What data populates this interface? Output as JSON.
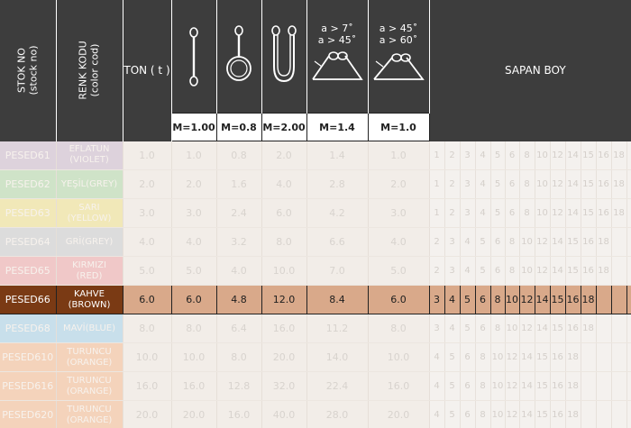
{
  "header": {
    "stok_label": "STOK NO",
    "stok_sub": "(stock no)",
    "renk_label": "RENK KODU",
    "renk_sub": "(color cod)",
    "ton_label": "TON ( t )",
    "sapan_label": "SAPAN BOY",
    "angle_a": [
      "a > 7˚",
      "a > 45˚"
    ],
    "angle_b": [
      "a > 45˚",
      "a > 60˚"
    ],
    "multipliers": [
      "M=1.00",
      "M=0.8",
      "M=2.00",
      "M=1.4",
      "M=1.0"
    ]
  },
  "rows": [
    {
      "stok": "PESED61",
      "renk": [
        "EFLATUN",
        "(VIOLET)"
      ],
      "color": "#ddd2dc",
      "ton": "1.0",
      "m": [
        "1.0",
        "0.8",
        "2.0",
        "1.4",
        "1.0"
      ],
      "sizes": [
        "1",
        "2",
        "3",
        "4",
        "5",
        "6",
        "8",
        "10",
        "12",
        "14",
        "15",
        "16",
        "18"
      ],
      "highlight": false
    },
    {
      "stok": "PESED62",
      "renk": [
        "YEŞİL(GREY)"
      ],
      "color": "#cfe3c8",
      "ton": "2.0",
      "m": [
        "2.0",
        "1.6",
        "4.0",
        "2.8",
        "2.0"
      ],
      "sizes": [
        "1",
        "2",
        "3",
        "4",
        "5",
        "6",
        "8",
        "10",
        "12",
        "14",
        "15",
        "16",
        "18"
      ],
      "highlight": false
    },
    {
      "stok": "PESED63",
      "renk": [
        "SARI",
        "(YELLOW)"
      ],
      "color": "#f1e8b8",
      "ton": "3.0",
      "m": [
        "3.0",
        "2.4",
        "6.0",
        "4.2",
        "3.0"
      ],
      "sizes": [
        "1",
        "2",
        "3",
        "4",
        "5",
        "6",
        "8",
        "10",
        "12",
        "14",
        "15",
        "16",
        "18"
      ],
      "highlight": false
    },
    {
      "stok": "PESED64",
      "renk": [
        "GRİ(GREY)"
      ],
      "color": "#dcdcdc",
      "ton": "4.0",
      "m": [
        "4.0",
        "3.2",
        "8.0",
        "6.6",
        "4.0"
      ],
      "sizes": [
        "2",
        "3",
        "4",
        "5",
        "6",
        "8",
        "10",
        "12",
        "14",
        "15",
        "16",
        "18"
      ],
      "highlight": false
    },
    {
      "stok": "PESED65",
      "renk": [
        "KIRMIZI",
        "(RED)"
      ],
      "color": "#f0c8c8",
      "ton": "5.0",
      "m": [
        "5.0",
        "4.0",
        "10.0",
        "7.0",
        "5.0"
      ],
      "sizes": [
        "2",
        "3",
        "4",
        "5",
        "6",
        "8",
        "10",
        "12",
        "14",
        "15",
        "16",
        "18"
      ],
      "highlight": false
    },
    {
      "stok": "PESED66",
      "renk": [
        "KAHVE",
        "(BROWN)"
      ],
      "color": "#7a3a14",
      "ton": "6.0",
      "m": [
        "6.0",
        "4.8",
        "12.0",
        "8.4",
        "6.0"
      ],
      "sizes": [
        "3",
        "4",
        "5",
        "6",
        "8",
        "10",
        "12",
        "14",
        "15",
        "16",
        "18"
      ],
      "highlight": true
    },
    {
      "stok": "PESED68",
      "renk": [
        "MAVİ(BLUE)"
      ],
      "color": "#c8dfeb",
      "ton": "8.0",
      "m": [
        "8.0",
        "6.4",
        "16.0",
        "11.2",
        "8.0"
      ],
      "sizes": [
        "3",
        "4",
        "5",
        "6",
        "8",
        "10",
        "12",
        "14",
        "15",
        "16",
        "18"
      ],
      "highlight": false
    },
    {
      "stok": "PESED610",
      "renk": [
        "TURUNCU",
        "(ORANGE)"
      ],
      "color": "#f4d3bb",
      "ton": "10.0",
      "m": [
        "10.0",
        "8.0",
        "20.0",
        "14.0",
        "10.0"
      ],
      "sizes": [
        "4",
        "5",
        "6",
        "8",
        "10",
        "12",
        "14",
        "15",
        "16",
        "18"
      ],
      "highlight": false
    },
    {
      "stok": "PESED616",
      "renk": [
        "TURUNCU",
        "(ORANGE)"
      ],
      "color": "#f4d3bb",
      "ton": "16.0",
      "m": [
        "16.0",
        "12.8",
        "32.0",
        "22.4",
        "16.0"
      ],
      "sizes": [
        "4",
        "5",
        "6",
        "8",
        "10",
        "12",
        "14",
        "15",
        "16",
        "18"
      ],
      "highlight": false
    },
    {
      "stok": "PESED620",
      "renk": [
        "TURUNCU",
        "(ORANGE)"
      ],
      "color": "#f4d3bb",
      "ton": "20.0",
      "m": [
        "20.0",
        "16.0",
        "40.0",
        "28.0",
        "20.0"
      ],
      "sizes": [
        "4",
        "5",
        "6",
        "8",
        "10",
        "12",
        "14",
        "15",
        "16",
        "18"
      ],
      "highlight": false
    }
  ]
}
